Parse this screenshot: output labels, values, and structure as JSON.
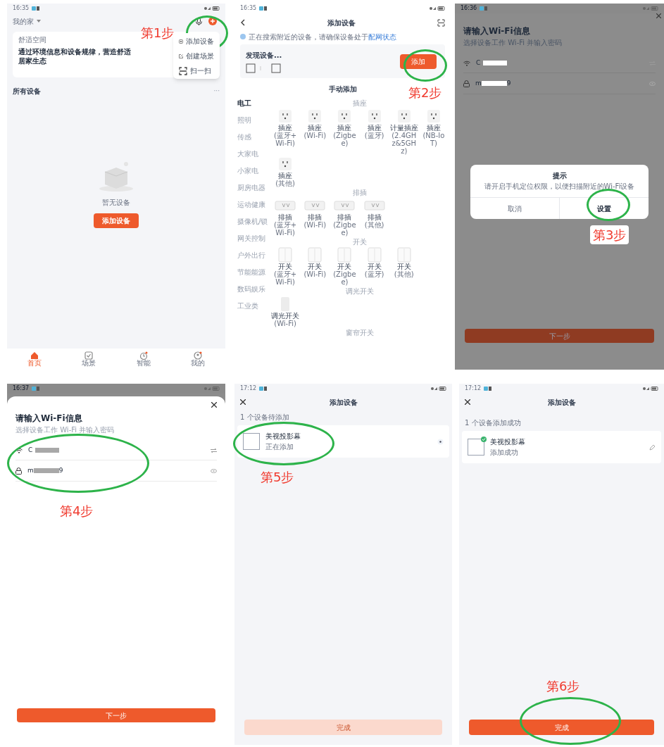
{
  "home": {
    "time": "16:35",
    "home_name": "我的家",
    "card_label": "舒适空间",
    "card_text": "通过环境信息和设备规律，营造舒适居家生态",
    "menu": [
      {
        "label": "添加设备",
        "kind": "add"
      },
      {
        "label": "创建场景",
        "kind": "scene"
      },
      {
        "label": "扫一扫",
        "kind": "scan"
      }
    ],
    "section_title": "所有设备",
    "more": "···",
    "empty_text": "暂无设备",
    "add_button": "添加设备",
    "tabs": [
      {
        "label": "首页",
        "kind": "home",
        "selected": true
      },
      {
        "label": "场景",
        "kind": "scene",
        "selected": false
      },
      {
        "label": "智能",
        "kind": "smart",
        "selected": false
      },
      {
        "label": "我的",
        "kind": "me",
        "selected": false
      }
    ]
  },
  "add_device": {
    "time": "16:35",
    "title": "添加设备",
    "notice": "正在搜索附近的设备，请确保设备处于",
    "notice_link": "配网状态",
    "discover_title": "发现设备...",
    "add_button": "添加",
    "manual_title": "手动添加",
    "categories": [
      {
        "label": "电工",
        "selected": true
      },
      {
        "label": "照明",
        "selected": false
      },
      {
        "label": "传感",
        "selected": false
      },
      {
        "label": "大家电",
        "selected": false
      },
      {
        "label": "小家电",
        "selected": false
      },
      {
        "label": "厨房电器",
        "selected": false
      },
      {
        "label": "运动健康",
        "selected": false
      },
      {
        "label": "摄像机/锁",
        "selected": false
      },
      {
        "label": "网关控制",
        "selected": false
      },
      {
        "label": "户外出行",
        "selected": false
      },
      {
        "label": "节能能源",
        "selected": false
      },
      {
        "label": "数码娱乐",
        "selected": false
      },
      {
        "label": "工业类",
        "selected": false
      }
    ],
    "sections": [
      {
        "title": "插座",
        "kind": "socket",
        "items": [
          {
            "name": "插座",
            "protocol": "(蓝牙+Wi-Fi)"
          },
          {
            "name": "插座",
            "protocol": "(Wi-Fi)"
          },
          {
            "name": "插座",
            "protocol": "(Zigbee)"
          },
          {
            "name": "插座",
            "protocol": "(蓝牙)"
          },
          {
            "name": "计量插座",
            "protocol": "(2.4GHz&5GHz)"
          },
          {
            "name": "插座",
            "protocol": "(NB-IoT)"
          },
          {
            "name": "插座",
            "protocol": "(其他)"
          }
        ]
      },
      {
        "title": "排插",
        "kind": "strip",
        "items": [
          {
            "name": "排插",
            "protocol": "(蓝牙+Wi-Fi)"
          },
          {
            "name": "排插",
            "protocol": "(Wi-Fi)"
          },
          {
            "name": "排插",
            "protocol": "(Zigbee)"
          },
          {
            "name": "排插",
            "protocol": "(其他)"
          }
        ]
      },
      {
        "title": "开关",
        "kind": "switch",
        "items": [
          {
            "name": "开关",
            "protocol": "(蓝牙+Wi-Fi)"
          },
          {
            "name": "开关",
            "protocol": "(Wi-Fi)"
          },
          {
            "name": "开关",
            "protocol": "(Zigbee)"
          },
          {
            "name": "开关",
            "protocol": "(蓝牙)"
          },
          {
            "name": "开关",
            "protocol": "(其他)"
          }
        ]
      },
      {
        "title": "调光开关",
        "kind": "dimmer",
        "items": [
          {
            "name": "调光开关",
            "protocol": "(Wi-Fi)"
          }
        ]
      },
      {
        "title": "窗帘开关"
      }
    ]
  },
  "wifi_prompt": {
    "time": "16:36",
    "title": "请输入Wi-Fi信息",
    "subtitle": "选择设备工作 Wi-Fi 并输入密码",
    "wifi_value": "C",
    "password_start": "m",
    "password_end": "9",
    "dialog": {
      "title": "提示",
      "message": "请开启手机定位权限，以便扫描附近的Wi-Fi设备",
      "buttons": [
        {
          "label": "取消",
          "primary": false
        },
        {
          "label": "设置",
          "primary": true
        }
      ]
    },
    "next_button": "下一步"
  },
  "wifi_form": {
    "time": "16:37",
    "title": "请输入Wi-Fi信息",
    "subtitle": "选择设备工作 Wi-Fi 并输入密码",
    "wifi_value": "C",
    "password_start": "m",
    "password_end": "9",
    "next_button": "下一步"
  },
  "adding": {
    "time": "17:12",
    "title": "添加设备",
    "count_text": "1 个设备待添加",
    "device": {
      "name": "美视投影幕",
      "status": "正在添加",
      "done": false
    },
    "button": {
      "label": "完成",
      "disabled": true
    }
  },
  "added": {
    "time": "17:12",
    "title": "添加设备",
    "count_text": "1 个设备添加成功",
    "device": {
      "name": "美视投影幕",
      "status": "添加成功",
      "done": true
    },
    "button": {
      "label": "完成",
      "disabled": false
    }
  },
  "annotations": [
    {
      "label": "第1步"
    },
    {
      "label": "第2步"
    },
    {
      "label": "第3步"
    },
    {
      "label": "第4步"
    },
    {
      "label": "第5步"
    },
    {
      "label": "第6步"
    }
  ]
}
